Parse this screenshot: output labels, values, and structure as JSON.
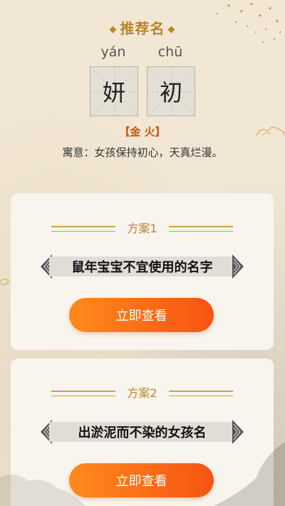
{
  "header": {
    "title": "推荐名",
    "diamond_left": "◆",
    "diamond_right": "◆"
  },
  "name": {
    "pinyin": [
      "yán",
      "chū"
    ],
    "chars": [
      "妍",
      "初"
    ],
    "elements": "【金 火】",
    "meaning": "寓意：女孩保持初心，天真烂漫。"
  },
  "plans": [
    {
      "label": "方案1",
      "banner": "鼠年宝宝不宜使用的名字",
      "button": "立即查看"
    },
    {
      "label": "方案2",
      "banner": "出淤泥而不染的女孩名",
      "button": "立即查看"
    }
  ],
  "colors": {
    "gold": "#b8862b",
    "orange_button": "#f65412",
    "element_tag": "#c25a12"
  }
}
